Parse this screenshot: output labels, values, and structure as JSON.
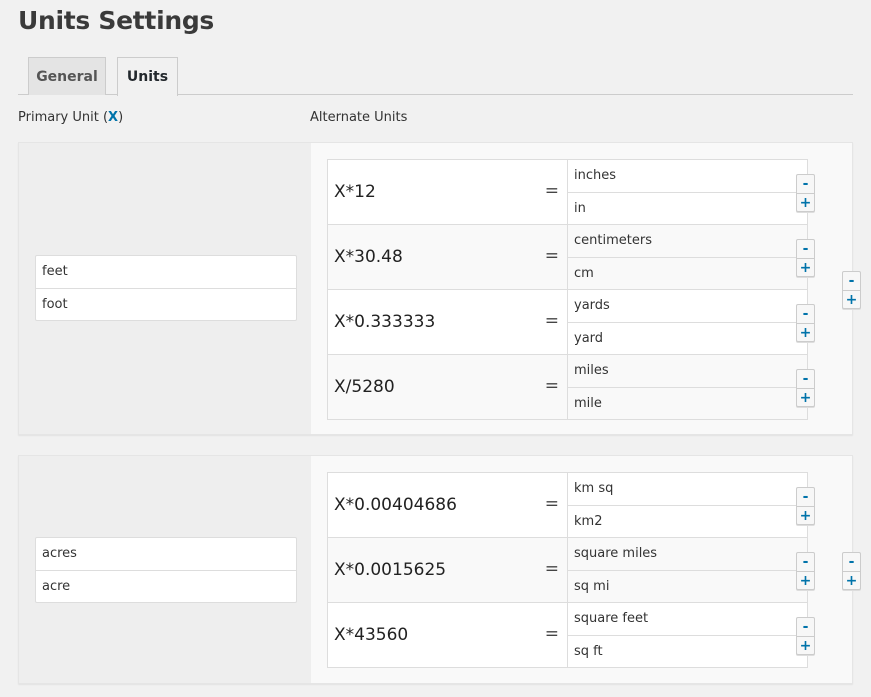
{
  "page": {
    "title": "Units Settings"
  },
  "tabs": [
    {
      "label": "General",
      "active": false
    },
    {
      "label": "Units",
      "active": true
    }
  ],
  "columns": {
    "primary_label_prefix": "Primary Unit (",
    "primary_label_var": "X",
    "primary_label_suffix": ")",
    "alternate_label": "Alternate Units"
  },
  "controls": {
    "remove_label": "-",
    "add_label": "+",
    "equals": "="
  },
  "groups": [
    {
      "primary": [
        "feet",
        "foot"
      ],
      "alternates": [
        {
          "formula": "X*12",
          "names": [
            "inches",
            "in"
          ]
        },
        {
          "formula": "X*30.48",
          "names": [
            "centimeters",
            "cm"
          ]
        },
        {
          "formula": "X*0.333333",
          "names": [
            "yards",
            "yard"
          ]
        },
        {
          "formula": "X/5280",
          "names": [
            "miles",
            "mile"
          ]
        }
      ]
    },
    {
      "primary": [
        "acres",
        "acre"
      ],
      "alternates": [
        {
          "formula": "X*0.00404686",
          "names": [
            "km sq",
            "km2"
          ]
        },
        {
          "formula": "X*0.0015625",
          "names": [
            "square miles",
            "sq mi"
          ]
        },
        {
          "formula": "X*43560",
          "names": [
            "square feet",
            "sq ft"
          ]
        }
      ]
    }
  ],
  "colors": {
    "accent": "#0073aa",
    "background": "#f1f1f1",
    "border": "#dddddd"
  }
}
